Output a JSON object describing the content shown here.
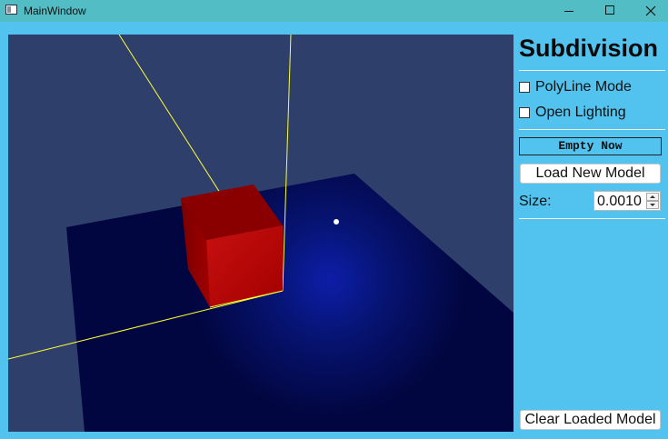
{
  "window": {
    "title": "MainWindow",
    "controls": [
      "minimize-icon",
      "maximize-icon",
      "close-icon"
    ]
  },
  "panel": {
    "heading": "Subdivision",
    "polyline_label": "PolyLine Mode",
    "polyline_checked": false,
    "lighting_label": "Open Lighting",
    "lighting_checked": false,
    "status": "Empty Now",
    "load_button": "Load New Model",
    "size_label": "Size:",
    "size_value": "0.0010",
    "clear_button": "Clear Loaded Model"
  },
  "scene": {
    "background_color": "#2e3f6b",
    "floor_color": "#020640",
    "cube_color": "#c00000",
    "axis_color": "#ffff33"
  }
}
